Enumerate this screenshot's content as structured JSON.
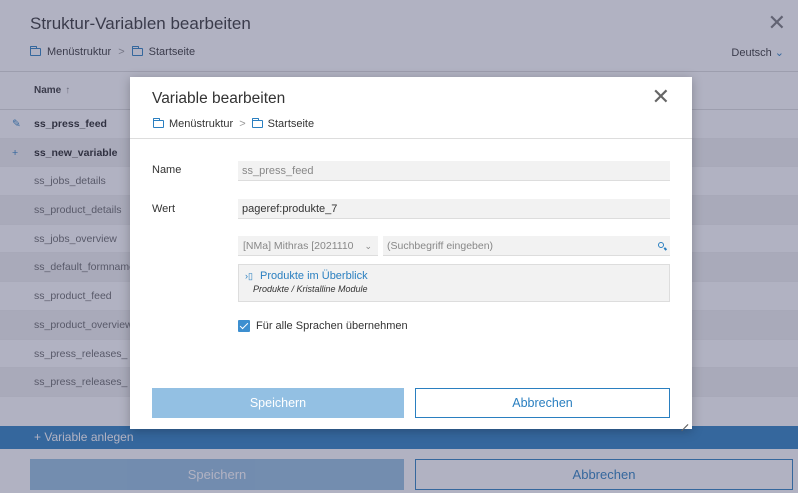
{
  "background": {
    "title": "Struktur-Variablen bearbeiten",
    "breadcrumb": [
      "Menüstruktur",
      "Startseite"
    ],
    "breadcrumb_separator": ">",
    "language": "Deutsch",
    "table": {
      "header": "Name",
      "sort_indicator": "↑",
      "rows": [
        {
          "name": "ss_press_feed",
          "lead_icon": "pencil-icon"
        },
        {
          "name": "ss_new_variable",
          "lead_icon": "plus-icon"
        },
        {
          "name": "ss_jobs_details"
        },
        {
          "name": "ss_product_details"
        },
        {
          "name": "ss_jobs_overview"
        },
        {
          "name": "ss_default_formname"
        },
        {
          "name": "ss_product_feed"
        },
        {
          "name": "ss_product_overview"
        },
        {
          "name": "ss_press_releases_"
        },
        {
          "name": "ss_press_releases_"
        }
      ]
    },
    "add_variable": "+ Variable anlegen",
    "save": "Speichern",
    "cancel": "Abbrechen"
  },
  "modal": {
    "title": "Variable bearbeiten",
    "breadcrumb": [
      "Menüstruktur",
      "Startseite"
    ],
    "breadcrumb_separator": ">",
    "name_label": "Name",
    "name_value": "ss_press_feed",
    "wert_label": "Wert",
    "wert_value": "pageref:produkte_7",
    "project_select": "[NMa] Mithras [2021110",
    "search_placeholder": "(Suchbegriff eingeben)",
    "result_title": "Produkte im Überblick",
    "result_path": "Produkte / Kristalline Module",
    "checkbox_label": "Für alle Sprachen übernehmen",
    "checkbox_checked": true,
    "save": "Speichern",
    "cancel": "Abbrechen"
  },
  "colors": {
    "accent": "#2a7fc0",
    "overlay": "#46486e"
  }
}
